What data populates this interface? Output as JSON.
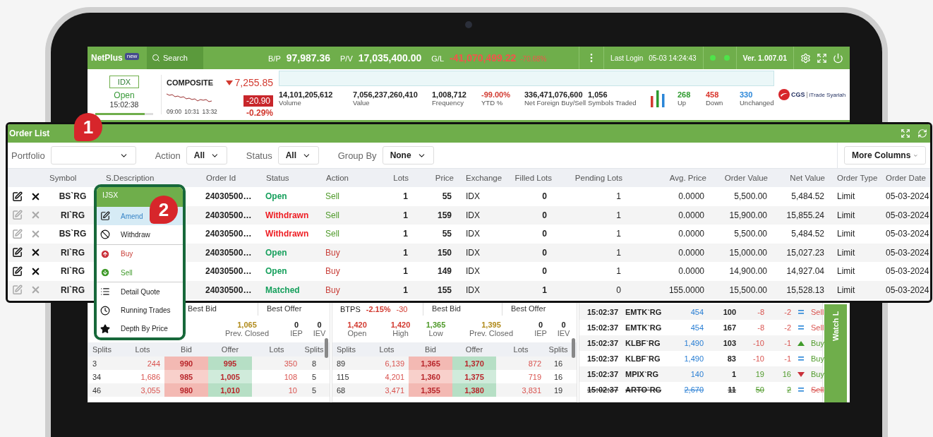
{
  "top_bar": {
    "brand": "NetPlus",
    "badge": "new",
    "search": "Search",
    "stats": [
      {
        "label": "B/P",
        "value": "97,987.36",
        "negative": false
      },
      {
        "label": "P/V",
        "value": "17,035,400.00",
        "negative": false
      },
      {
        "label": "G/L",
        "value": "-41,070,499.22",
        "change": "-70.68%",
        "negative": true
      }
    ],
    "last_login_label": "Last Login",
    "last_login": "05-03 14:24:43",
    "version": "Ver. 1.007.01"
  },
  "market": {
    "exchange": "IDX",
    "status": "Open",
    "time": "15:02:38",
    "level": 0.85
  },
  "index": {
    "name": "COMPOSITE",
    "value": "7,255.85",
    "falling": true,
    "change": "-20.90",
    "change_pct": "-0.29%",
    "times": [
      "09:00",
      "10:31",
      "13:32"
    ]
  },
  "summary": [
    {
      "value": "14,101,205,612",
      "label": "Volume",
      "negative": false
    },
    {
      "value": "7,056,237,260,410",
      "label": "Value",
      "negative": false
    },
    {
      "value": "1,008,712",
      "label": "Frequency",
      "negative": false
    },
    {
      "value": "-99.00%",
      "label": "YTD %",
      "negative": true
    },
    {
      "value": "336,471,076,600",
      "label": "Net Foreign Buy/Sell",
      "negative": false
    },
    {
      "value": "1,056",
      "label": "Symbols Traded",
      "negative": false
    }
  ],
  "breadth": [
    {
      "value": "268",
      "label": "Up",
      "color": "#2e9a2e"
    },
    {
      "value": "458",
      "label": "Down",
      "color": "#d9342b"
    },
    {
      "value": "330",
      "label": "Unchanged",
      "color": "#2a86d8"
    }
  ],
  "logo": {
    "name": "CGS",
    "product": "iTrade Syariah"
  },
  "order_list": {
    "title": "Order List",
    "filters": [
      {
        "label": "Portfolio"
      },
      {
        "label": "Action",
        "value": "All"
      },
      {
        "label": "Status",
        "value": "All"
      },
      {
        "label": "Group By",
        "value": "None"
      }
    ],
    "more_columns": "More Columns",
    "columns": [
      "Symbol",
      "S.Description",
      "Order Id",
      "Status",
      "Action",
      "Lots",
      "Price",
      "Exchange",
      "Filled Lots",
      "Pending Lots",
      "Avg. Price",
      "Order Value",
      "Net Value",
      "Order Type",
      "Order Date"
    ],
    "rows": [
      {
        "disabled": false,
        "symbol": "BS`RG",
        "order_id": "24030500…",
        "status": "Open",
        "withdrawn": false,
        "action": "Sell",
        "is_buy": false,
        "lots": "1",
        "price": "55",
        "exchange": "IDX",
        "filled_lots": "0",
        "pending_lots": "1",
        "avg_price": "0.0000",
        "order_value": "5,500.00",
        "net_value": "5,484.52",
        "order_type": "Limit",
        "order_date": "05-03-2024"
      },
      {
        "disabled": true,
        "symbol": "RI`RG",
        "order_id": "24030500…",
        "status": "Withdrawn",
        "withdrawn": true,
        "action": "Sell",
        "is_buy": false,
        "lots": "1",
        "price": "159",
        "exchange": "IDX",
        "filled_lots": "0",
        "pending_lots": "1",
        "avg_price": "0.0000",
        "order_value": "15,900.00",
        "net_value": "15,855.24",
        "order_type": "Limit",
        "order_date": "05-03-2024"
      },
      {
        "disabled": true,
        "symbol": "BS`RG",
        "order_id": "24030500…",
        "status": "Withdrawn",
        "withdrawn": true,
        "action": "Sell",
        "is_buy": false,
        "lots": "1",
        "price": "55",
        "exchange": "IDX",
        "filled_lots": "0",
        "pending_lots": "1",
        "avg_price": "0.0000",
        "order_value": "5,500.00",
        "net_value": "5,484.52",
        "order_type": "Limit",
        "order_date": "05-03-2024"
      },
      {
        "disabled": false,
        "symbol": "RI`RG",
        "order_id": "24030500…",
        "status": "Open",
        "withdrawn": false,
        "action": "Buy",
        "is_buy": true,
        "lots": "1",
        "price": "150",
        "exchange": "IDX",
        "filled_lots": "0",
        "pending_lots": "1",
        "avg_price": "0.0000",
        "order_value": "15,000.00",
        "net_value": "15,027.23",
        "order_type": "Limit",
        "order_date": "05-03-2024"
      },
      {
        "disabled": false,
        "symbol": "RI`RG",
        "order_id": "24030500…",
        "status": "Open",
        "withdrawn": false,
        "action": "Buy",
        "is_buy": true,
        "lots": "1",
        "price": "149",
        "exchange": "IDX",
        "filled_lots": "0",
        "pending_lots": "1",
        "avg_price": "0.0000",
        "order_value": "14,900.00",
        "net_value": "14,927.04",
        "order_type": "Limit",
        "order_date": "05-03-2024"
      },
      {
        "disabled": true,
        "symbol": "RI`RG",
        "order_id": "24030500…",
        "status": "Matched",
        "withdrawn": false,
        "action": "Buy",
        "is_buy": true,
        "lots": "1",
        "price": "155",
        "exchange": "IDX",
        "filled_lots": "1",
        "pending_lots": "0",
        "avg_price": "155.0000",
        "order_value": "15,500.00",
        "net_value": "15,528.13",
        "order_type": "Limit",
        "order_date": "05-03-2024"
      }
    ]
  },
  "context_menu": {
    "title": "IJSX",
    "groups": [
      {
        "items": [
          {
            "label": "Amend",
            "kind": "amend",
            "selected": true
          },
          {
            "label": "Withdraw",
            "kind": "withdraw",
            "selected": false
          }
        ]
      },
      {
        "items": [
          {
            "label": "Buy",
            "kind": "buy",
            "selected": false
          },
          {
            "label": "Sell",
            "kind": "sell",
            "selected": false
          }
        ]
      },
      {
        "items": [
          {
            "label": "Detail Quote",
            "kind": "detail",
            "selected": false
          },
          {
            "label": "Running Trades",
            "kind": "trades",
            "selected": false
          },
          {
            "label": "Depth By Price",
            "kind": "depth",
            "selected": false
          }
        ]
      }
    ]
  },
  "depth_panels": [
    {
      "best_bid": "Best Bid",
      "best_offer": "Best Offer",
      "stats": [
        {
          "kind": "prev_closed",
          "value": "1,065",
          "label": "Prev. Closed"
        },
        {
          "kind": "iep",
          "value": "0",
          "label": "IEP"
        },
        {
          "kind": "iev",
          "value": "0",
          "label": "IEV"
        }
      ],
      "columns": [
        "Splits",
        "Lots",
        "Bid",
        "Offer",
        "Lots",
        "Splits"
      ],
      "rows": [
        [
          "3",
          "244",
          "990",
          "995",
          "350",
          "8"
        ],
        [
          "34",
          "1,686",
          "985",
          "1,005",
          "108",
          "5"
        ],
        [
          "46",
          "3,055",
          "980",
          "1,010",
          "10",
          "5"
        ]
      ]
    },
    {
      "symbol": "BTPS",
      "change_pct": "-2.15%",
      "change": "-30",
      "best_bid": "Best Bid",
      "best_offer": "Best Offer",
      "stats": [
        {
          "kind": "open",
          "value": "1,420",
          "label": "Open"
        },
        {
          "kind": "high",
          "value": "1,420",
          "label": "High"
        },
        {
          "kind": "low",
          "value": "1,365",
          "label": "Low"
        },
        {
          "kind": "prev_closed",
          "value": "1,395",
          "label": "Prev. Closed"
        },
        {
          "kind": "iep",
          "value": "0",
          "label": "IEP"
        },
        {
          "kind": "iev",
          "value": "0",
          "label": "IEV"
        }
      ],
      "columns": [
        "Splits",
        "Lots",
        "Bid",
        "Offer",
        "Lots",
        "Splits"
      ],
      "rows": [
        [
          "89",
          "6,139",
          "1,365",
          "1,370",
          "872",
          "16"
        ],
        [
          "115",
          "4,201",
          "1,360",
          "1,375",
          "719",
          "16"
        ],
        [
          "68",
          "3,471",
          "1,355",
          "1,380",
          "3,831",
          "19"
        ]
      ]
    }
  ],
  "time_and_sales": [
    {
      "time": "15:02:37",
      "symbol": "EMTK`RG",
      "price": "454",
      "volume": "100",
      "change": "-8",
      "change_pct": "-2",
      "rising": false,
      "kind": "flat",
      "side": "Sell",
      "is_buy": false,
      "struck": false
    },
    {
      "time": "15:02:37",
      "symbol": "EMTK`RG",
      "price": "454",
      "volume": "167",
      "change": "-8",
      "change_pct": "-2",
      "rising": false,
      "kind": "flat",
      "side": "Sell",
      "is_buy": false,
      "struck": false
    },
    {
      "time": "15:02:37",
      "symbol": "KLBF`RG",
      "price": "1,490",
      "volume": "103",
      "change": "-10",
      "change_pct": "-1",
      "rising": false,
      "kind": "up",
      "side": "Buy",
      "is_buy": true,
      "struck": false
    },
    {
      "time": "15:02:37",
      "symbol": "KLBF`RG",
      "price": "1,490",
      "volume": "83",
      "change": "-10",
      "change_pct": "-1",
      "rising": false,
      "kind": "flat",
      "side": "Buy",
      "is_buy": true,
      "struck": false
    },
    {
      "time": "15:02:37",
      "symbol": "MPIX`RG",
      "price": "140",
      "volume": "1",
      "change": "19",
      "change_pct": "16",
      "rising": true,
      "kind": "down",
      "side": "Buy",
      "is_buy": true,
      "struck": false
    },
    {
      "time": "15:02:37",
      "symbol": "ARTO`RG",
      "price": "2,670",
      "volume": "11",
      "change": "50",
      "change_pct": "2",
      "rising": true,
      "kind": "flat",
      "side": "Sell",
      "is_buy": false,
      "struck": true
    }
  ],
  "watch_list_tab": "Watch L",
  "callouts": [
    {
      "label": "1"
    },
    {
      "label": "2"
    }
  ]
}
